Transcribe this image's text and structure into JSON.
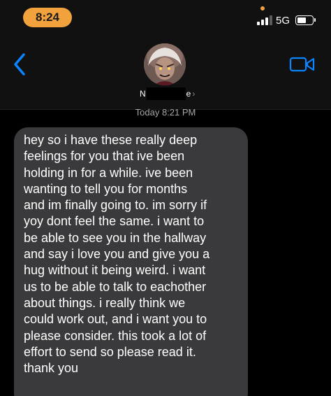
{
  "status_bar": {
    "time": "8:24",
    "network": "5G",
    "time_pill_color": "#f2a23c",
    "icons": [
      "cellular-signal-icon",
      "battery-icon"
    ]
  },
  "conversation_header": {
    "contact_name_visible_start": "N",
    "contact_name_visible_end": "e",
    "contact_name_chevron": "›",
    "back_icon": "chevron-left-icon",
    "video_icon": "facetime-video-icon",
    "accent_color": "#0a84ff"
  },
  "messages": {
    "timestamp": "Today 8:21 PM",
    "bubble_color": "#3a3a3c",
    "items": [
      {
        "direction": "incoming",
        "text": "hey so i have these really deep\nfeelings for you that ive been\nholding in for a while. ive been\nwanting to tell you for months\nand im finally going to. im sorry if\nyoy dont feel the same. i want to\nbe able to see you in the hallway\nand say i love you and give you a\nhug without it being weird. i want\nus to be able to talk to eachother\nabout things. i really think we\ncould work out, and i want you to\nplease consider. this took a lot of\neffort to send so please read it.\nthank you"
      }
    ]
  }
}
